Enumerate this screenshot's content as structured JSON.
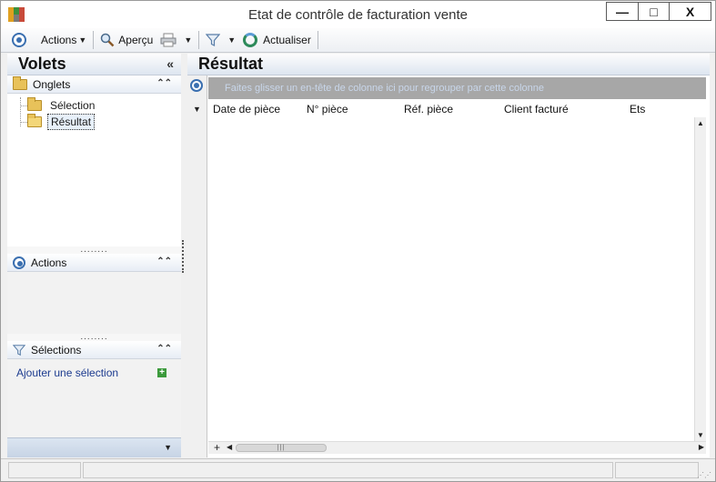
{
  "window": {
    "title": "Etat de contrôle de facturation vente",
    "minimize_label": "—",
    "maximize_label": "□",
    "close_label": "X"
  },
  "toolbar": {
    "actions_label": "Actions",
    "apercu_label": "Aperçu",
    "actualiser_label": "Actualiser"
  },
  "left_panel": {
    "title": "Volets",
    "collapse_glyph": "«",
    "onglets": {
      "header": "Onglets",
      "items": [
        {
          "label": "Sélection",
          "selected": false
        },
        {
          "label": "Résultat",
          "selected": true
        }
      ]
    },
    "actions": {
      "header": "Actions"
    },
    "selections": {
      "header": "Sélections",
      "add_link": "Ajouter une sélection"
    }
  },
  "right_panel": {
    "title": "Résultat",
    "group_hint": "Faites glisser un en-tête de colonne ici pour regrouper par cette colonne",
    "columns": [
      "Date de pièce",
      "N° pièce",
      "Réf. pièce",
      "Client facturé",
      "Ets"
    ]
  },
  "colors": {
    "accent": "#3a6fb0",
    "header_gradient_end": "#dde6f0",
    "group_bar": "#a7a7a7",
    "link": "#1c3b8f"
  }
}
